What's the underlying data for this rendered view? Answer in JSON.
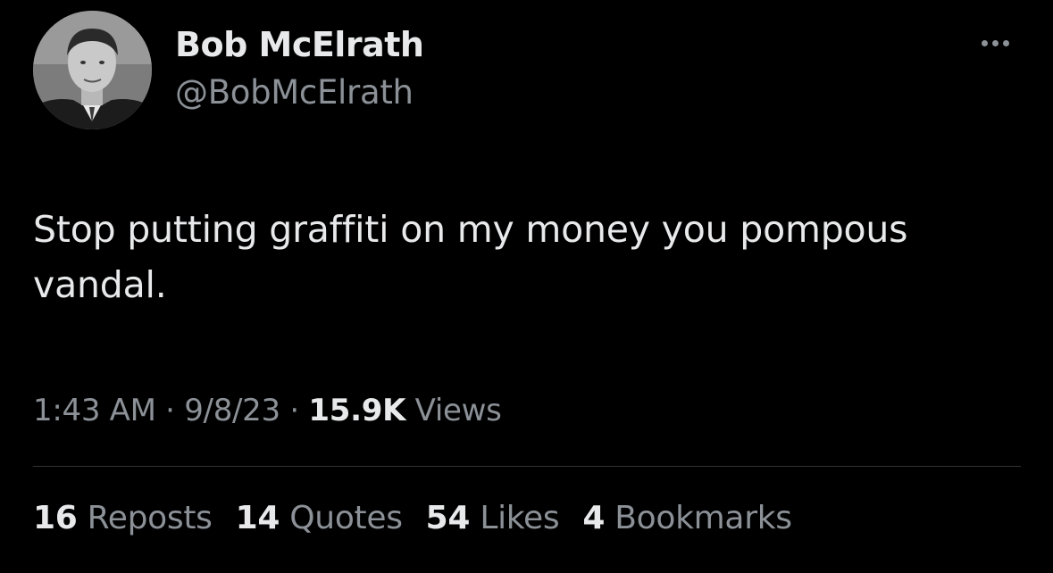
{
  "author": {
    "display_name": "Bob McElrath",
    "handle": "@BobMcElrath",
    "avatar_icon": "profile-photo"
  },
  "tweet": {
    "text": "Stop putting graffiti on my money you pompous vandal."
  },
  "meta": {
    "time": "1:43 AM",
    "separator": "·",
    "date": "9/8/23",
    "views_count": "15.9K",
    "views_label": "Views"
  },
  "stats": {
    "reposts": {
      "count": "16",
      "label": "Reposts"
    },
    "quotes": {
      "count": "14",
      "label": "Quotes"
    },
    "likes": {
      "count": "54",
      "label": "Likes"
    },
    "bookmarks": {
      "count": "4",
      "label": "Bookmarks"
    }
  },
  "icons": {
    "more": "more-horizontal-icon"
  },
  "colors": {
    "background": "#000000",
    "primary_text": "#e7e9ea",
    "secondary_text": "#8b9197",
    "divider": "#2f3336"
  }
}
